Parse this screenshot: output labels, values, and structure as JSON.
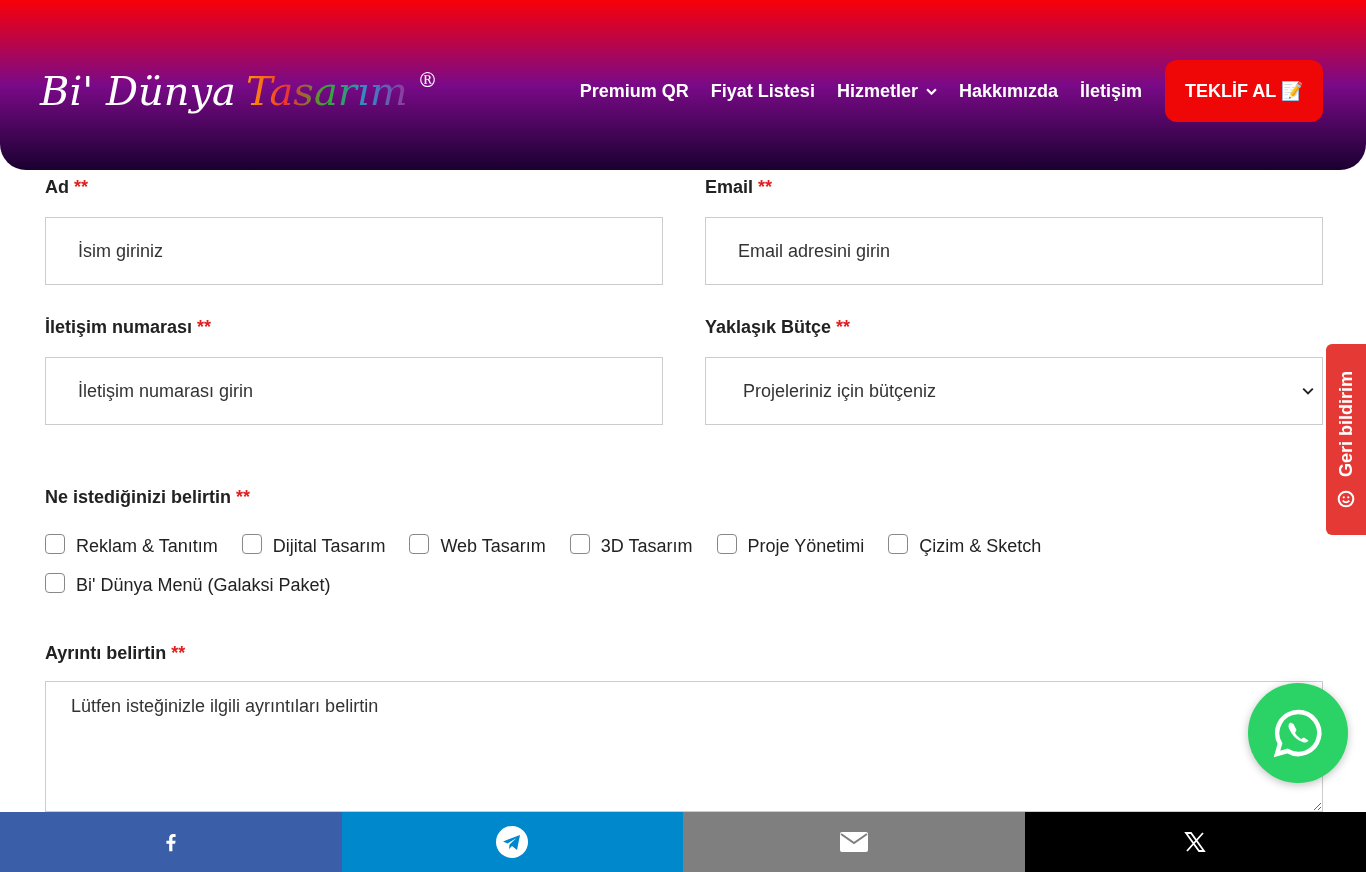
{
  "header": {
    "logo": {
      "part1": "Bi' Dünya",
      "part2": "Tasarım",
      "mark": "®"
    },
    "nav": [
      {
        "label": "Premium QR",
        "dropdown": false
      },
      {
        "label": "Fiyat Listesi",
        "dropdown": false
      },
      {
        "label": "Hizmetler",
        "dropdown": true
      },
      {
        "label": "Hakkımızda",
        "dropdown": false
      },
      {
        "label": "İletişim",
        "dropdown": false
      }
    ],
    "cta": "TEKLİF AL 📝"
  },
  "form": {
    "fields": [
      {
        "label": "Ad",
        "required": "**",
        "kind": "input",
        "placeholder": "İsim giriniz"
      },
      {
        "label": "Email",
        "required": "**",
        "kind": "input",
        "placeholder": "Email adresini girin"
      },
      {
        "label": "İletişim numarası",
        "required": "**",
        "kind": "input",
        "placeholder": "İletişim numarası girin"
      },
      {
        "label": "Yaklaşık Bütçe",
        "required": "**",
        "kind": "select",
        "placeholder": "Projeleriniz için bütçeniz"
      }
    ],
    "choices": {
      "label": "Ne istediğinizi belirtin",
      "required": "**",
      "options": [
        {
          "label": "Reklam & Tanıtım",
          "checked": false
        },
        {
          "label": "Dijital Tasarım",
          "checked": false
        },
        {
          "label": "Web Tasarım",
          "checked": false
        },
        {
          "label": "3D Tasarım",
          "checked": false
        },
        {
          "label": "Proje Yönetimi",
          "checked": false
        },
        {
          "label": "Çizim & Sketch",
          "checked": false
        },
        {
          "label": "Bi' Dünya Menü (Galaksi Paket)",
          "checked": false
        }
      ]
    },
    "details": {
      "label": "Ayrıntı belirtin",
      "required": "**",
      "placeholder": "Lütfen isteğinizle ilgili ayrıntıları belirtin"
    }
  },
  "feedback_tab": "Geri bildirim",
  "share_bar": [
    {
      "kind": "facebook",
      "color": "#3b5ea8"
    },
    {
      "kind": "telegram",
      "color": "#0088cc"
    },
    {
      "kind": "email",
      "color": "#7f7f7f"
    },
    {
      "kind": "x",
      "color": "#000000"
    }
  ]
}
